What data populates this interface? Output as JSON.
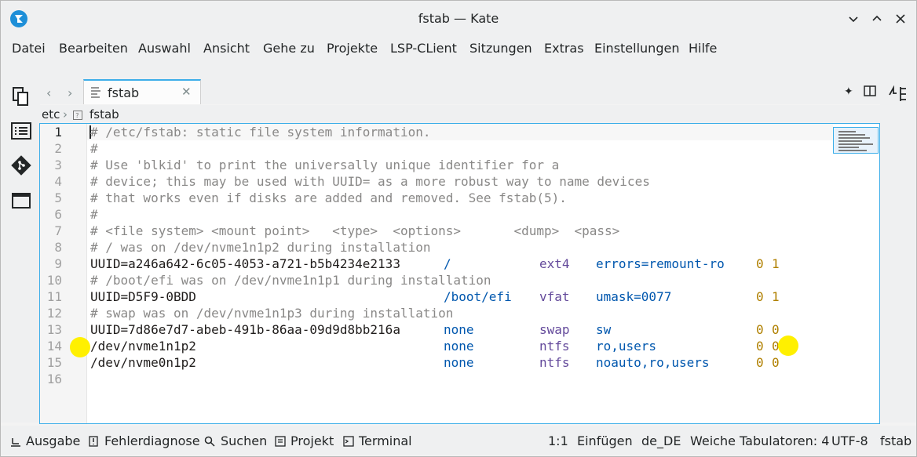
{
  "window": {
    "title": "fstab — Kate"
  },
  "menu": [
    "Datei",
    "Bearbeiten",
    "Auswahl",
    "Ansicht",
    "Gehe zu",
    "Projekte",
    "LSP-CLient",
    "Sitzungen",
    "Extras",
    "Einstellungen",
    "Hilfe"
  ],
  "tab": {
    "label": "fstab"
  },
  "breadcrumb": {
    "folder": "etc",
    "file": "fstab"
  },
  "editor": {
    "line_numbers": [
      "1",
      "2",
      "3",
      "4",
      "5",
      "6",
      "7",
      "8",
      "9",
      "10",
      "11",
      "12",
      "13",
      "14",
      "15",
      "16"
    ],
    "lines": [
      "# /etc/fstab: static file system information.",
      "#",
      "# Use 'blkid' to print the universally unique identifier for a",
      "# device; this may be used with UUID= as a more robust way to name devices",
      "# that works even if disks are added and removed. See fstab(5).",
      "#",
      "# <file system> <mount point>   <type>  <options>       <dump>  <pass>",
      "# / was on /dev/nvme1n1p2 during installation",
      [
        "UUID=a246a642-6c05-4053-a721-b5b4234e2133",
        "/",
        "ext4",
        "errors=remount-ro",
        "0",
        "1"
      ],
      "# /boot/efi was on /dev/nvme1n1p1 during installation",
      [
        "UUID=D5F9-0BDD",
        "/boot/efi",
        "vfat",
        "umask=0077",
        "0",
        "1"
      ],
      "# swap was on /dev/nvme1n1p3 during installation",
      [
        "UUID=7d86e7d7-abeb-491b-86aa-09d9d8bb216a",
        "none",
        "swap",
        "sw",
        "0",
        "0"
      ],
      [
        "/dev/nvme1n1p2",
        "none",
        "ntfs",
        "ro,users",
        "0",
        "0"
      ],
      [
        "/dev/nvme0n1p2",
        "none",
        "ntfs",
        "noauto,ro,users",
        "0",
        "0"
      ],
      ""
    ]
  },
  "statusbar": {
    "output": "Ausgabe",
    "diagnostics": "Fehlerdiagnose",
    "search": "Suchen",
    "project": "Projekt",
    "terminal": "Terminal",
    "position": "1:1",
    "mode": "Einfügen",
    "language": "de_DE",
    "indent": "Weiche Tabulatoren: 4",
    "encoding": "UTF-8",
    "filetype": "fstab"
  },
  "colors": {
    "accent": "#3daee9",
    "highlight": "#fff000"
  }
}
